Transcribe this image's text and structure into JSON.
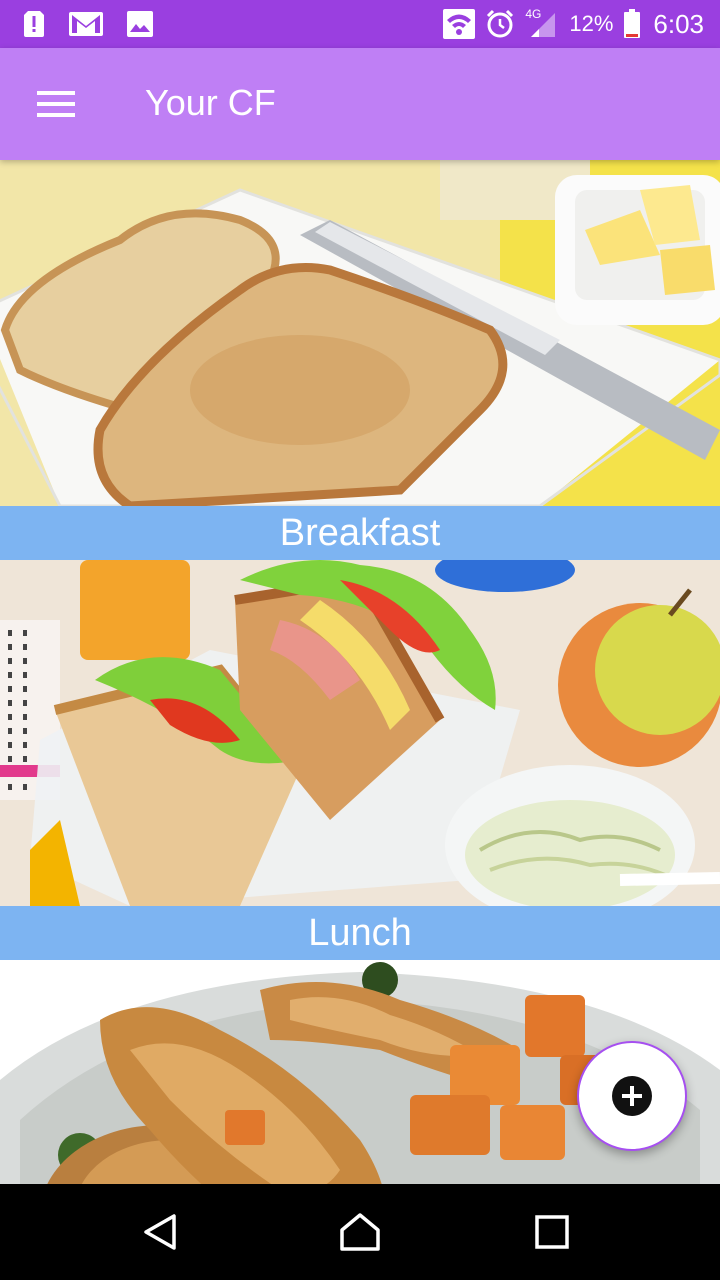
{
  "status_bar": {
    "time": "6:03",
    "battery_percent": "12%",
    "network": "4G",
    "icons": [
      "alert-icon",
      "gmail-icon",
      "gallery-icon",
      "wifi-icon",
      "alarm-icon",
      "signal-icon",
      "battery-icon"
    ]
  },
  "app_bar": {
    "title": "Your CF",
    "menu_icon": "hamburger-menu-icon"
  },
  "meals": [
    {
      "label": "Breakfast",
      "image": "toast-with-butter-photo"
    },
    {
      "label": "Lunch",
      "image": "sandwich-lunchbox-photo"
    },
    {
      "label": "",
      "image": "roast-chicken-sweet-potato-photo"
    }
  ],
  "fab": {
    "icon": "add-circle-icon"
  },
  "nav_bar": {
    "icons": [
      "back-icon",
      "home-icon",
      "recents-icon"
    ]
  },
  "colors": {
    "status_bar": "#9a3fe0",
    "app_bar": "#bf7ff5",
    "caption_bar": "#7db4f2",
    "fab_border": "#a64ff0"
  }
}
